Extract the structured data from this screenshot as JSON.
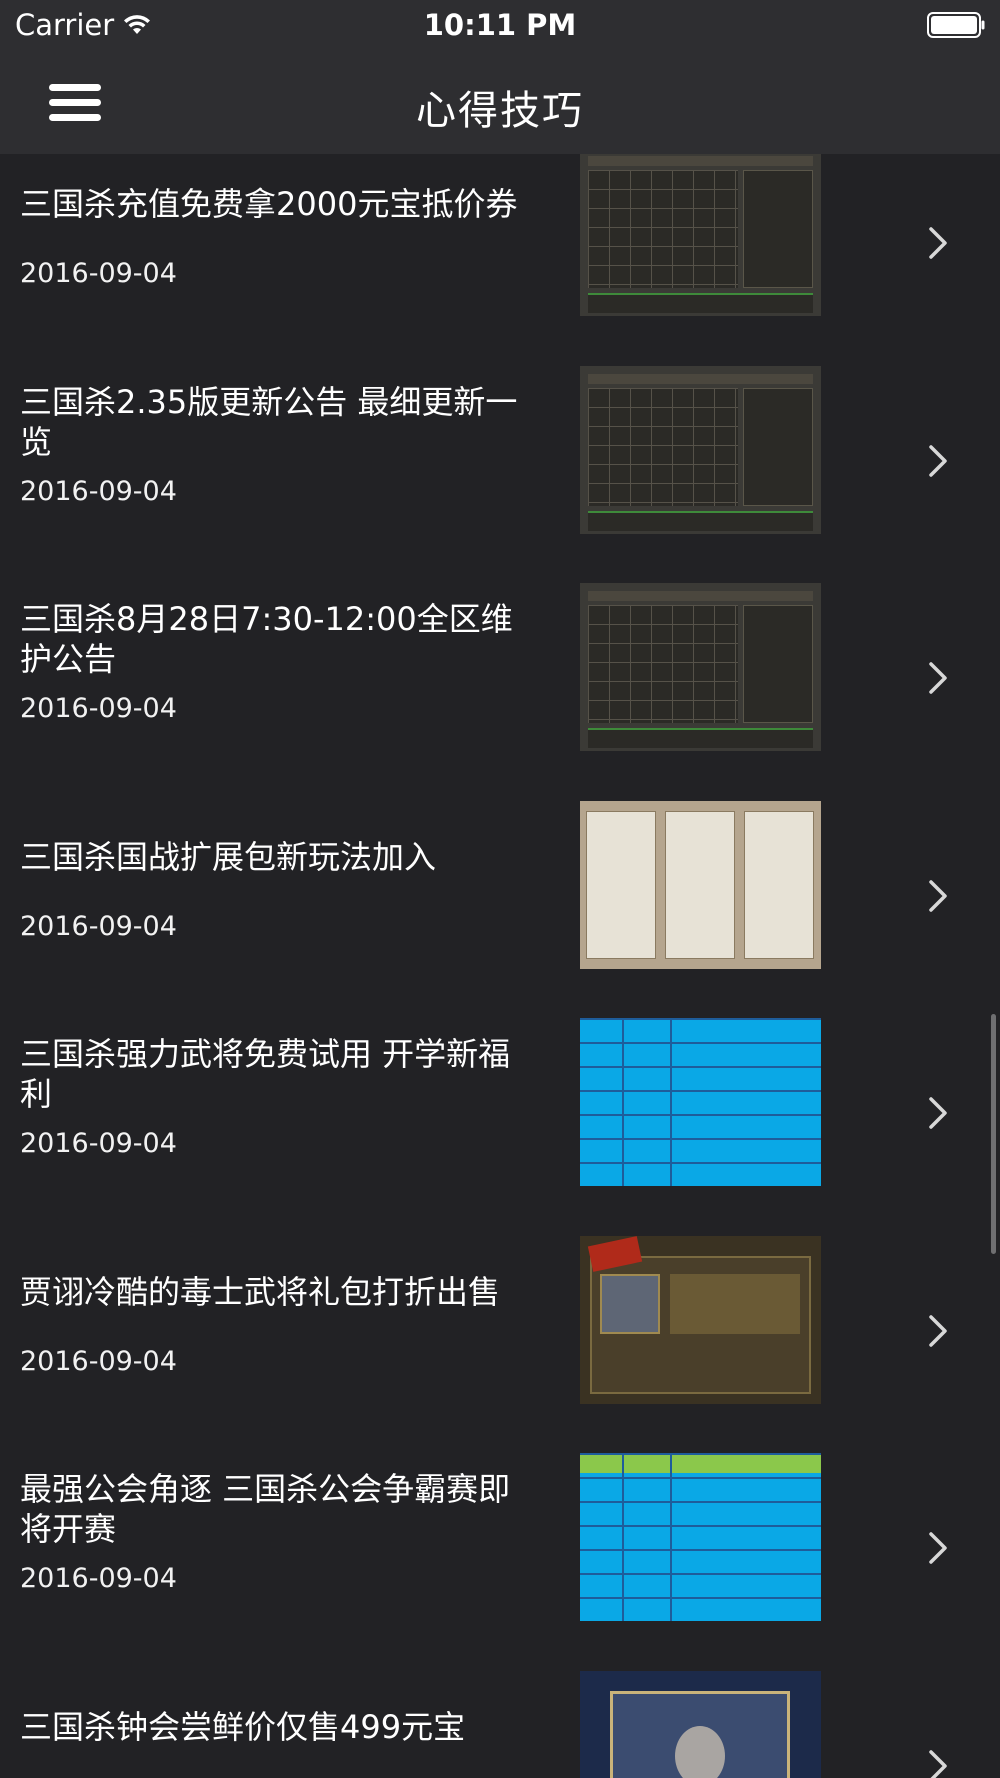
{
  "status_bar": {
    "carrier": "Carrier",
    "time": "10:11 PM"
  },
  "nav": {
    "title": "心得技巧"
  },
  "items": [
    {
      "title": "三国杀充值免费拿2000元宝抵价券",
      "date": "2016-09-04",
      "thumb": "calendar"
    },
    {
      "title": "三国杀2.35版更新公告 最细更新一览",
      "date": "2016-09-04",
      "thumb": "calendar"
    },
    {
      "title": "三国杀8月28日7:30-12:00全区维护公告",
      "date": "2016-09-04",
      "thumb": "calendar"
    },
    {
      "title": "三国杀国战扩展包新玩法加入",
      "date": "2016-09-04",
      "thumb": "guide"
    },
    {
      "title": "三国杀强力武将免费试用 开学新福利",
      "date": "2016-09-04",
      "thumb": "table"
    },
    {
      "title": "贾诩冷酷的毒士武将礼包打折出售",
      "date": "2016-09-04",
      "thumb": "gift"
    },
    {
      "title": "最强公会角逐 三国杀公会争霸赛即将开赛",
      "date": "2016-09-04",
      "thumb": "table-header"
    },
    {
      "title": "三国杀钟会尝鲜价仅售499元宝",
      "date": "",
      "thumb": "card"
    }
  ]
}
